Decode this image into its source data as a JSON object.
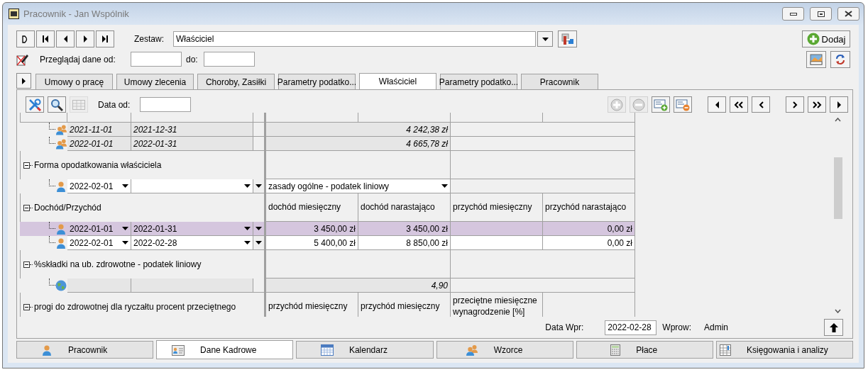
{
  "window": {
    "title": "Pracownik - Jan Wspólnik"
  },
  "toolbar": {
    "set_label": "Zestaw:",
    "set_value": "Właściciel",
    "add_button": "Dodaj",
    "browse_label": "Przeglądaj dane od:",
    "to_label": "do:"
  },
  "tabs": [
    {
      "label": "Umowy o pracę",
      "selected": false
    },
    {
      "label": "Umowy zlecenia",
      "selected": false
    },
    {
      "label": "Choroby, Zasiłki",
      "selected": false
    },
    {
      "label": "Parametry podatko...",
      "selected": false
    },
    {
      "label": "Właściciel",
      "selected": true
    },
    {
      "label": "Parametry podatko...",
      "selected": false
    },
    {
      "label": "Pracownik",
      "selected": false
    }
  ],
  "panel": {
    "tool_buttons": [
      {
        "disabled": false
      },
      {
        "disabled": false
      },
      {
        "disabled": true
      }
    ],
    "date_from_label": "Data od:",
    "record_buttons": [
      {
        "disabled": true
      },
      {
        "disabled": true
      },
      {
        "disabled": false
      },
      {
        "disabled": false
      }
    ]
  },
  "grid": {
    "groups": [
      {
        "children": [
          {
            "kind": "people",
            "editable": false,
            "selected": false,
            "from": "2021-11-01",
            "to": "2021-12-31",
            "cells": [
              {
                "kind": "readonly",
                "text": "4 242,38 zł"
              },
              {
                "kind": "none"
              }
            ]
          },
          {
            "kind": "people",
            "editable": false,
            "selected": false,
            "from": "2022-01-01",
            "to": "2022-01-31",
            "cells": [
              {
                "kind": "readonly",
                "text": "4 665,78 zł"
              },
              {
                "kind": "none"
              }
            ]
          }
        ]
      },
      {
        "label": "Forma opodatkowania właściciela",
        "expanded": true,
        "children": [
          {
            "kind": "person",
            "editable": true,
            "selected": false,
            "from": "2022-02-01",
            "cells": [
              {
                "kind": "dropdown",
                "text": "zasady ogólne - podatek liniowy"
              },
              {
                "kind": "none"
              }
            ]
          }
        ]
      },
      {
        "label": "Dochód/Przychód",
        "expanded": true,
        "headers": [
          "dochód miesięczny",
          "dochód narastająco",
          "przychód miesięczny",
          "przychód narastająco"
        ],
        "children": [
          {
            "kind": "person",
            "editable": true,
            "selected": true,
            "from": "2022-01-01",
            "to": "2022-01-31",
            "cells": [
              {
                "kind": "input",
                "text": "3 450,00 zł"
              },
              {
                "kind": "input",
                "text": "3 450,00 zł"
              },
              {
                "kind": "input"
              },
              {
                "kind": "input",
                "text": "0,00 zł"
              }
            ]
          },
          {
            "kind": "person",
            "editable": true,
            "selected": false,
            "from": "2022-02-01",
            "to": "2022-02-28",
            "cells": [
              {
                "kind": "input",
                "text": "5 400,00 zł"
              },
              {
                "kind": "input",
                "text": "8 850,00 zł"
              },
              {
                "kind": "input"
              },
              {
                "kind": "input",
                "text": "0,00 zł"
              }
            ]
          }
        ]
      },
      {
        "label": "%składki na ub. zdrowotne - podatek liniowy",
        "expanded": true,
        "children": [
          {
            "kind": "globe",
            "editable": false,
            "selected": false,
            "cells": [
              {
                "kind": "readonly",
                "text": "4,90"
              },
              {
                "kind": "none"
              }
            ]
          }
        ]
      },
      {
        "label": "progi do zdrowotnej dla ryczałtu procent przeciętnego",
        "expanded": true,
        "headers": [
          "przychód miesięczny",
          "przychód miesięczny",
          "przeciętne miesięczne wynagrodzenie [%]"
        ]
      }
    ]
  },
  "footer": {
    "entry_date_label": "Data Wpr:",
    "entry_date": "2022-02-28",
    "entered_by_label": "Wprow:",
    "entered_by": "Admin"
  },
  "bottom_tabs": [
    {
      "label": "Pracownik",
      "selected": false
    },
    {
      "label": "Dane Kadrowe",
      "selected": true
    },
    {
      "label": "Kalendarz",
      "selected": false
    },
    {
      "label": "Wzorce",
      "selected": false
    },
    {
      "label": "Płace",
      "selected": false
    },
    {
      "label": "Księgowania i analizy",
      "selected": false
    }
  ]
}
